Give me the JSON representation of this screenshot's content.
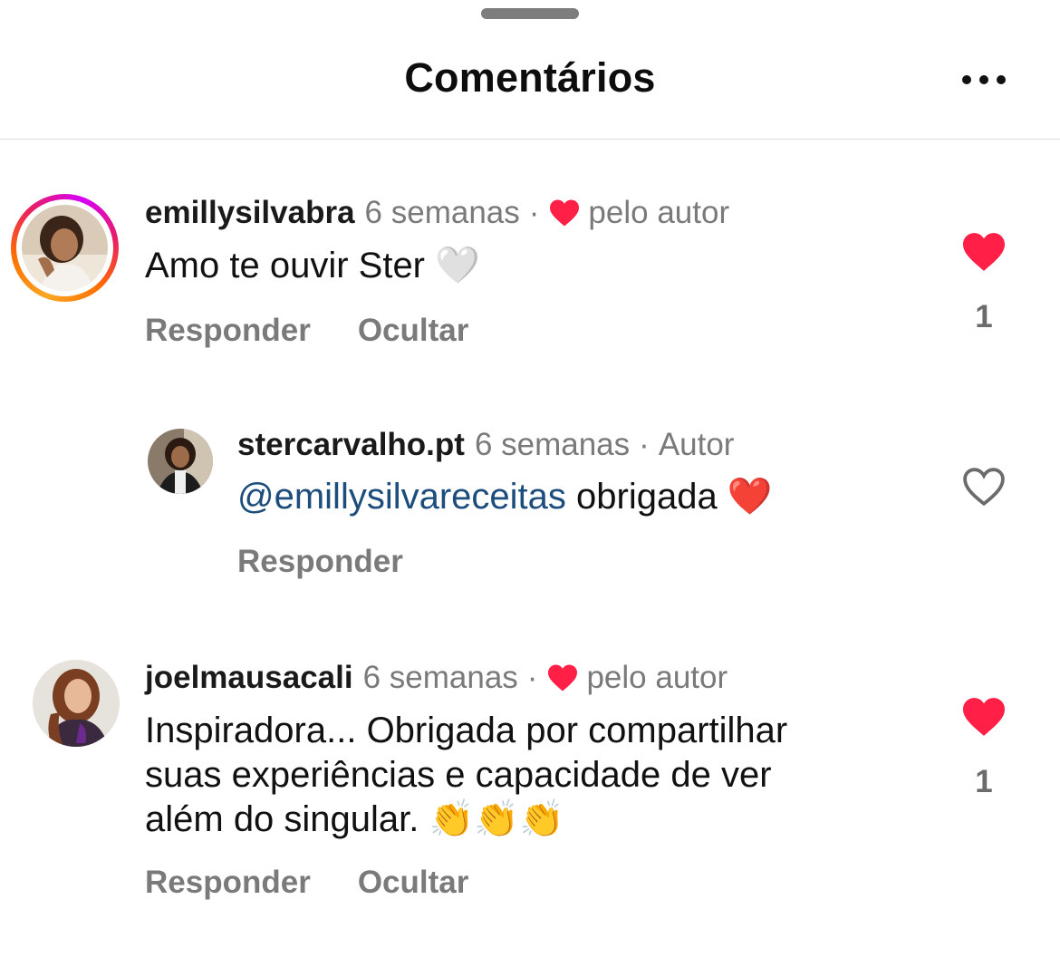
{
  "header": {
    "title": "Comentários"
  },
  "comments": [
    {
      "username": "emillysilvabra",
      "time": "6 semanas",
      "separator": "·",
      "badge": "pelo autor",
      "text": "Amo te ouvir Ster",
      "emoji": "🤍",
      "actions": [
        "Responder",
        "Ocultar"
      ],
      "likes": "1"
    },
    {
      "username": "stercarvalho.pt",
      "time": "6 semanas",
      "separator": "·",
      "badge": "Autor",
      "mention": "@emillysilvareceitas",
      "text": "obrigada",
      "emoji": "❤️",
      "actions": [
        "Responder"
      ]
    },
    {
      "username": "joelmausacali",
      "time": "6 semanas",
      "separator": "·",
      "badge": "pelo autor",
      "text_lines": [
        "Inspiradora... Obrigada por compartilhar",
        "suas experiências e capacidade de ver",
        "além do singular."
      ],
      "emoji": "👏👏👏",
      "actions": [
        "Responder",
        "Ocultar"
      ],
      "likes": "1"
    }
  ],
  "colors": {
    "like_red": "#ff1f47",
    "mention_blue": "#1d4d7c",
    "secondary_gray": "#7a7a7a"
  },
  "icons": {
    "more": "more-horizontal-icon",
    "liked": "heart-filled-icon",
    "unliked": "heart-outline-icon"
  }
}
